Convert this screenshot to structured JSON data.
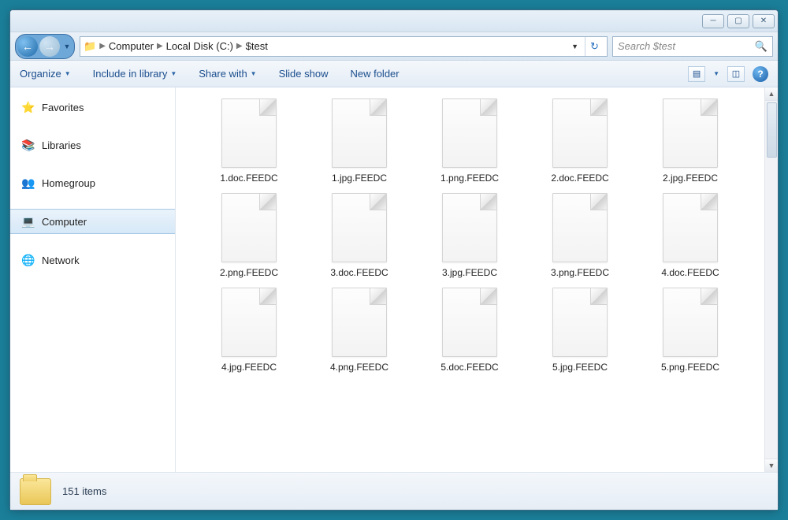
{
  "breadcrumb": {
    "seg1": "Computer",
    "seg2": "Local Disk (C:)",
    "seg3": "$test"
  },
  "search": {
    "placeholder": "Search $test"
  },
  "toolbar": {
    "organize": "Organize",
    "include": "Include in library",
    "share": "Share with",
    "slideshow": "Slide show",
    "newfolder": "New folder"
  },
  "sidebar": {
    "favorites": "Favorites",
    "libraries": "Libraries",
    "homegroup": "Homegroup",
    "computer": "Computer",
    "network": "Network"
  },
  "files": [
    "1.doc.FEEDC",
    "1.jpg.FEEDC",
    "1.png.FEEDC",
    "2.doc.FEEDC",
    "2.jpg.FEEDC",
    "2.png.FEEDC",
    "3.doc.FEEDC",
    "3.jpg.FEEDC",
    "3.png.FEEDC",
    "4.doc.FEEDC",
    "4.jpg.FEEDC",
    "4.png.FEEDC",
    "5.doc.FEEDC",
    "5.jpg.FEEDC",
    "5.png.FEEDC"
  ],
  "status": {
    "count": "151 items"
  }
}
